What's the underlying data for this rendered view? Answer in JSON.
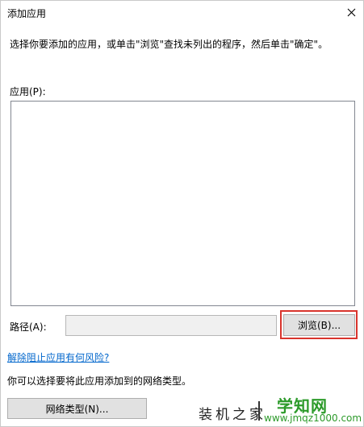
{
  "window": {
    "title": "添加应用"
  },
  "instruction": "选择你要添加的应用，或单击\"浏览\"查找未列出的程序，然后单击\"确定\"。",
  "apps": {
    "label": "应用(P):",
    "items": []
  },
  "path": {
    "label": "路径(A):",
    "value": "",
    "browse_label": "浏览(B)..."
  },
  "risk_link": "解除阻止应用有何风险?",
  "network": {
    "hint": "你可以选择要将此应用添加到的网络类型。",
    "button_label": "网络类型(N)..."
  },
  "watermark": {
    "text": "装机之家",
    "logo": "学知网",
    "url": "www.jmqz1000.com"
  },
  "colors": {
    "highlight_border": "#d9342c",
    "link": "#0066cc",
    "watermark_green": "#2c9a2a"
  },
  "icons": {
    "close": "close-icon"
  }
}
